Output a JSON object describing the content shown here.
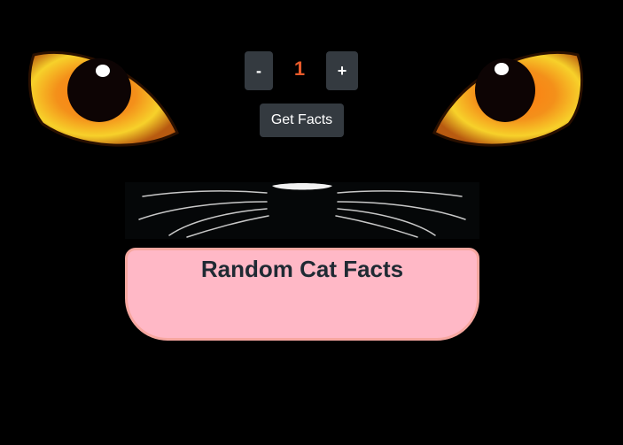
{
  "controls": {
    "decrement_label": "-",
    "count": "1",
    "increment_label": "+",
    "get_facts_label": "Get Facts"
  },
  "facts": {
    "title": "Random Cat Facts"
  },
  "colors": {
    "background": "#000000",
    "button_bg": "#343a40",
    "count_color": "#e85a2a",
    "facts_box_bg": "#ffb8c6",
    "facts_box_border": "#f7a7a0"
  },
  "icons": {
    "left_eye": "cat-eye-icon",
    "right_eye": "cat-eye-icon",
    "whiskers": "cat-nose-whiskers-image"
  }
}
